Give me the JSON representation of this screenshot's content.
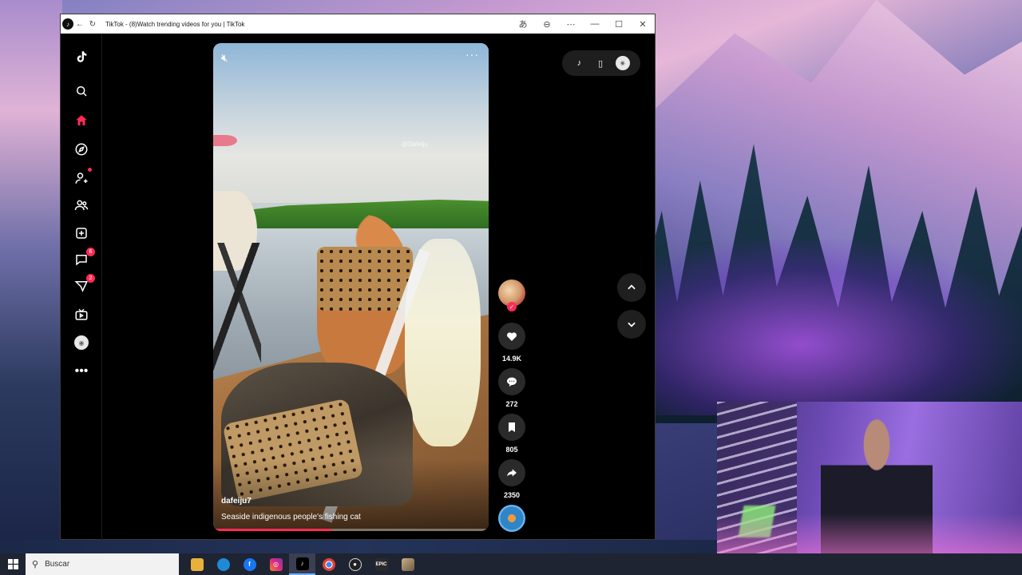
{
  "window": {
    "title": "TikTok - (8)Watch trending videos for you | TikTok",
    "app_icon": "tiktok-icon"
  },
  "sidebar": {
    "items": [
      {
        "name": "tiktok-logo",
        "icon": "tiktok-icon"
      },
      {
        "name": "search",
        "icon": "search-icon"
      },
      {
        "name": "home",
        "icon": "home-icon"
      },
      {
        "name": "explore",
        "icon": "compass-icon"
      },
      {
        "name": "following",
        "icon": "user-add-icon"
      },
      {
        "name": "friends",
        "icon": "users-icon"
      },
      {
        "name": "upload",
        "icon": "plus-square-icon"
      },
      {
        "name": "messages",
        "icon": "message-icon",
        "badge": "6"
      },
      {
        "name": "activity",
        "icon": "send-icon",
        "badge": "2"
      },
      {
        "name": "live",
        "icon": "tv-icon"
      },
      {
        "name": "profile",
        "icon": "avatar-icon"
      },
      {
        "name": "more",
        "icon": "more-icon"
      }
    ],
    "messages_badge": "6",
    "activity_badge": "2"
  },
  "video": {
    "watermark": "@Dafeiju",
    "author": "dafeiju7",
    "caption": "Seaside indigenous people's fishing cat",
    "progress": 0.43
  },
  "actions": {
    "likes": "14.9K",
    "comments": "272",
    "saves": "805",
    "shares": "2350"
  },
  "taskbar": {
    "search_placeholder": "Buscar",
    "apps": [
      "file-explorer",
      "edge",
      "facebook",
      "instagram",
      "tiktok",
      "chrome",
      "obs",
      "epic-games",
      "game"
    ]
  },
  "colors": {
    "accent": "#fe2c55",
    "window_bg": "#000000",
    "taskbar_bg": "#1f2433"
  }
}
